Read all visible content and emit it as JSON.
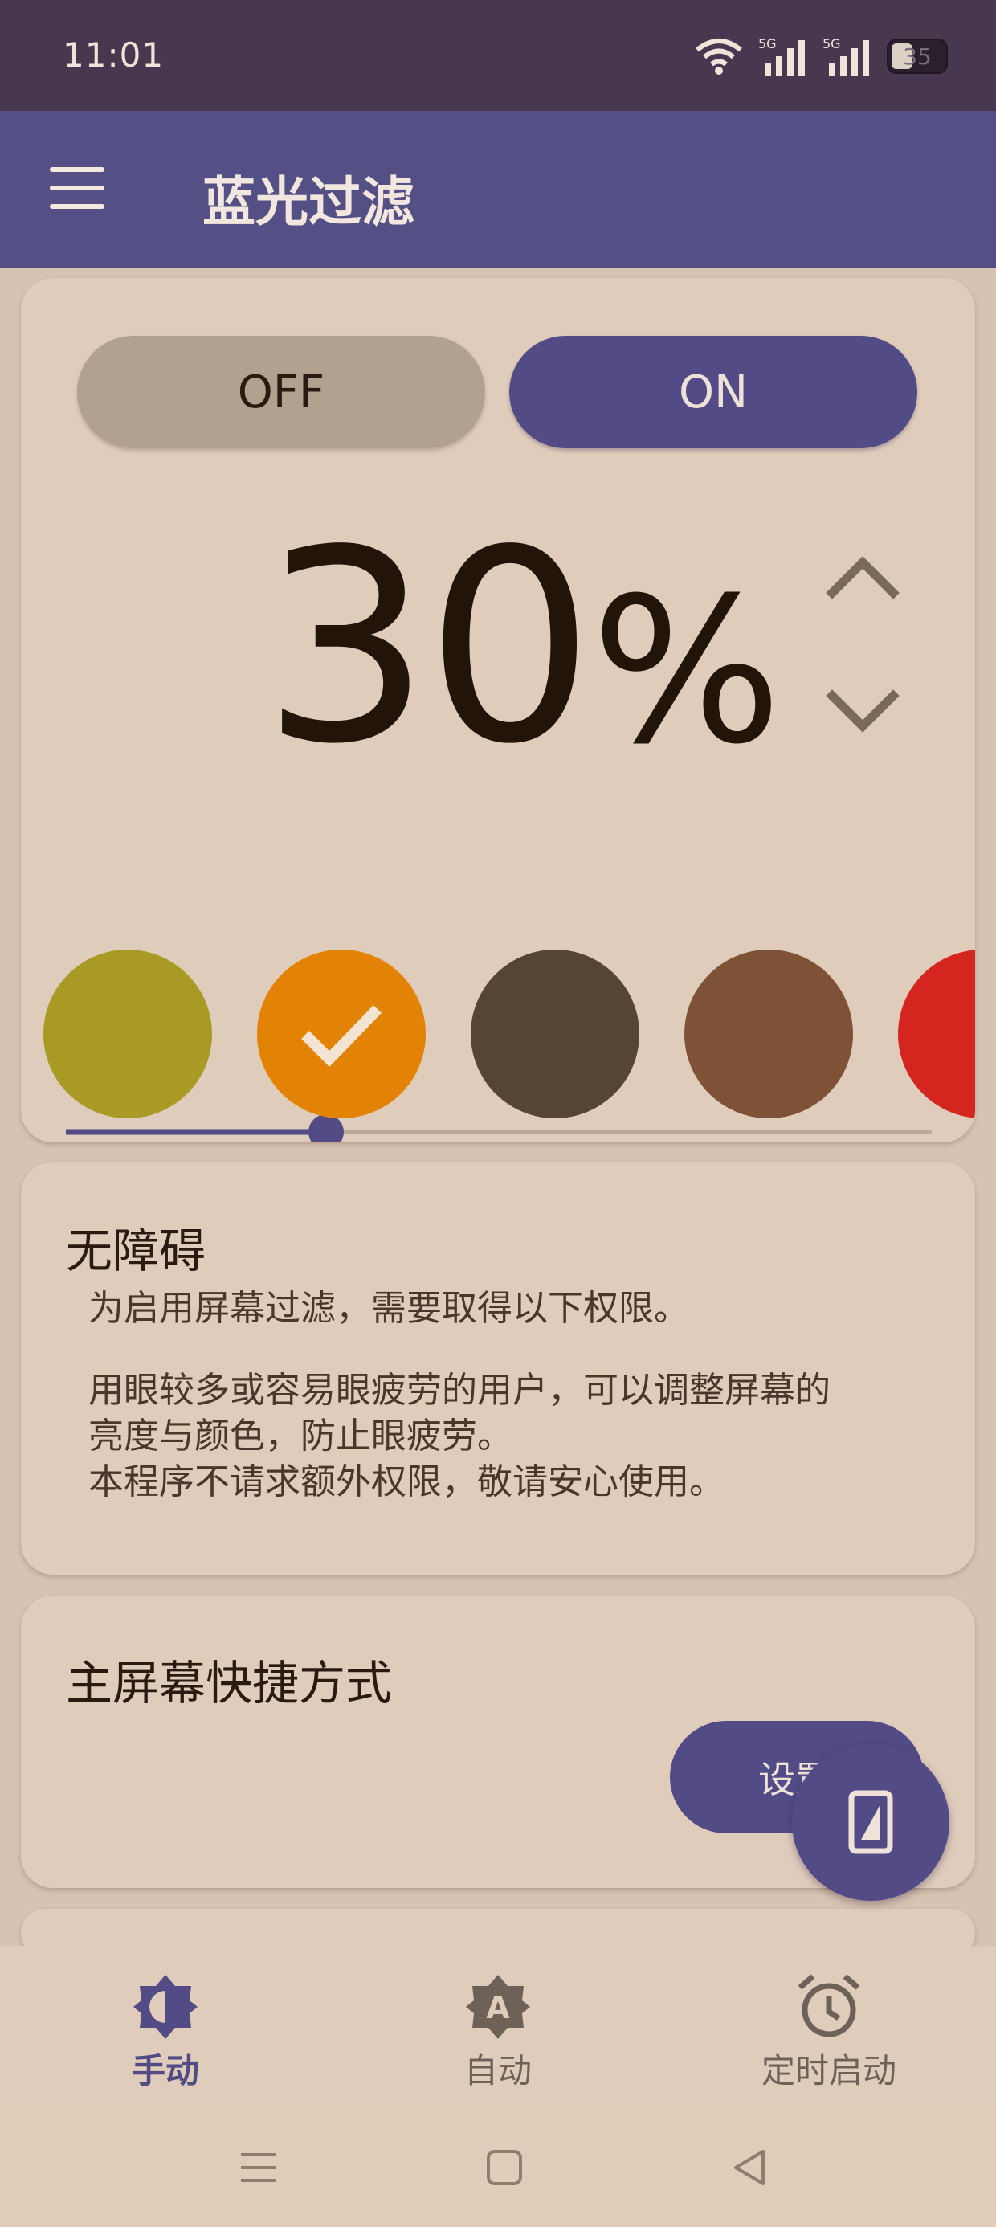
{
  "status_bar": {
    "time": "11:01",
    "battery": "35",
    "network": "5G"
  },
  "app_bar": {
    "title": "蓝光过滤"
  },
  "filter_card": {
    "off_label": "OFF",
    "on_label": "ON",
    "selected": "ON",
    "intensity_value": "30",
    "intensity_unit": "%",
    "slider_fraction": 0.3,
    "swatches": [
      {
        "color": "#a89a24",
        "selected": false
      },
      {
        "color": "#e38305",
        "selected": true
      },
      {
        "color": "#574533",
        "selected": false
      },
      {
        "color": "#7d5237",
        "selected": false
      },
      {
        "color": "#d4261e",
        "selected": false
      }
    ]
  },
  "accessibility_card": {
    "title": "无障碍",
    "line1": "为启用屏幕过滤，需要取得以下权限。",
    "line2": "用眼较多或容易眼疲劳的用户，可以调整屏幕的",
    "line3": "亮度与颜色，防止眼疲劳。",
    "line4": "本程序不请求额外权限，敬请安心使用。"
  },
  "shortcut_card": {
    "title": "主屏幕快捷方式",
    "button_label": "设置"
  },
  "bottom_nav": [
    {
      "label": "手动",
      "active": true
    },
    {
      "label": "自动",
      "active": false
    },
    {
      "label": "定时启动",
      "active": false
    }
  ],
  "colors": {
    "accent": "#524b85",
    "app_bar": "#545085",
    "background": "#d7c3b1",
    "card": "#dfccbb"
  }
}
